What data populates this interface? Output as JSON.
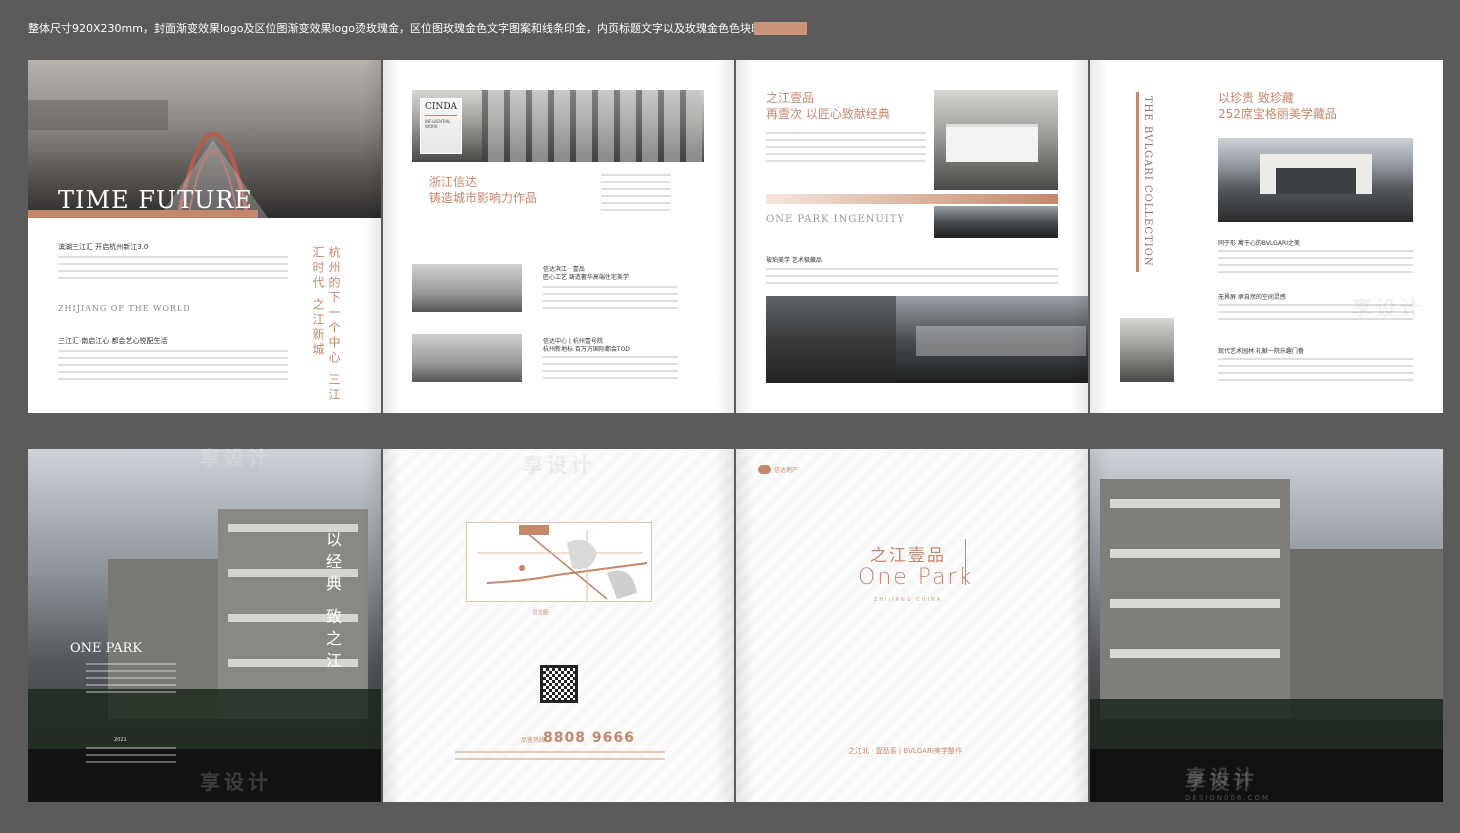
{
  "header": {
    "note": "整体尺寸920X230mm，封面渐变效果logo及区位图渐变效果logo烫玫瑰金，区位图玫瑰金色文字图案和线条印金，内页标题文字以及玫瑰金色色块印专色金",
    "swatch_color": "#c99479"
  },
  "colors": {
    "rose_gold": "#c5876a",
    "background": "#5b5b5b"
  },
  "spread1": {
    "p1": {
      "hero_title": "TIME FUTURE",
      "heading1": "滨湖三江汇  开启杭州新江3.0",
      "subtitle": "ZHIJIANG OF THE WORLD",
      "heading2": "三江汇·南启江心  都会艺心悦配生活",
      "vertical_slogan": "杭州的下一个中心 三江汇时代 之江新城"
    },
    "p2": {
      "cinda_label": "CINDA",
      "cinda_sub1": "INFLUENTIAL",
      "cinda_sub2": "WORK",
      "title_line1": "浙江信达",
      "title_line2": "铸造城市影响力作品",
      "block1_title1": "信达滨江 · 壹品",
      "block1_title2": "匠心工艺  铸造奢华高端住宅美学",
      "block2_title1": "信达中心 | 杭州壹号院",
      "block2_title2": "杭州新地标  百万方国际都会TOD"
    },
    "p3": {
      "title_line1": "之江壹品",
      "title_line2": "再壹次  以匠心致献经典",
      "ingenuity": "ONE PARK INGENUITY",
      "caption": "玻珀美学  艺术极藏品"
    },
    "p4": {
      "vertical_en": "THE BVLGARI COLLECTION",
      "title_line1": "以珍贵  致珍藏",
      "title_line2": "252席宝格丽美学藏品",
      "section1": "同于形  寓于心的BVLGARI之美",
      "section2": "无界屏  承自然的空间灵感",
      "section3": "现代艺术园林  礼献一院乐趣门眷"
    }
  },
  "spread2": {
    "p5": {
      "vertical_slogan": "以经典  致之江",
      "brand": "ONE PARK",
      "year": "2021"
    },
    "p6": {
      "phone_prefix": "品鉴热线",
      "phone": "8808 9666",
      "map_label": "区位图"
    },
    "p7": {
      "logo_text": "信达地产",
      "cn_title": "之江壹品",
      "en_title": "One Park",
      "en_sub": "ZHIJIANG CHINA",
      "tagline": "之江北 · 壹品系 | BVLGARI美学整作"
    },
    "p8": {}
  },
  "watermark": {
    "cn": "享设计",
    "en": "DESIGN006.COM"
  }
}
